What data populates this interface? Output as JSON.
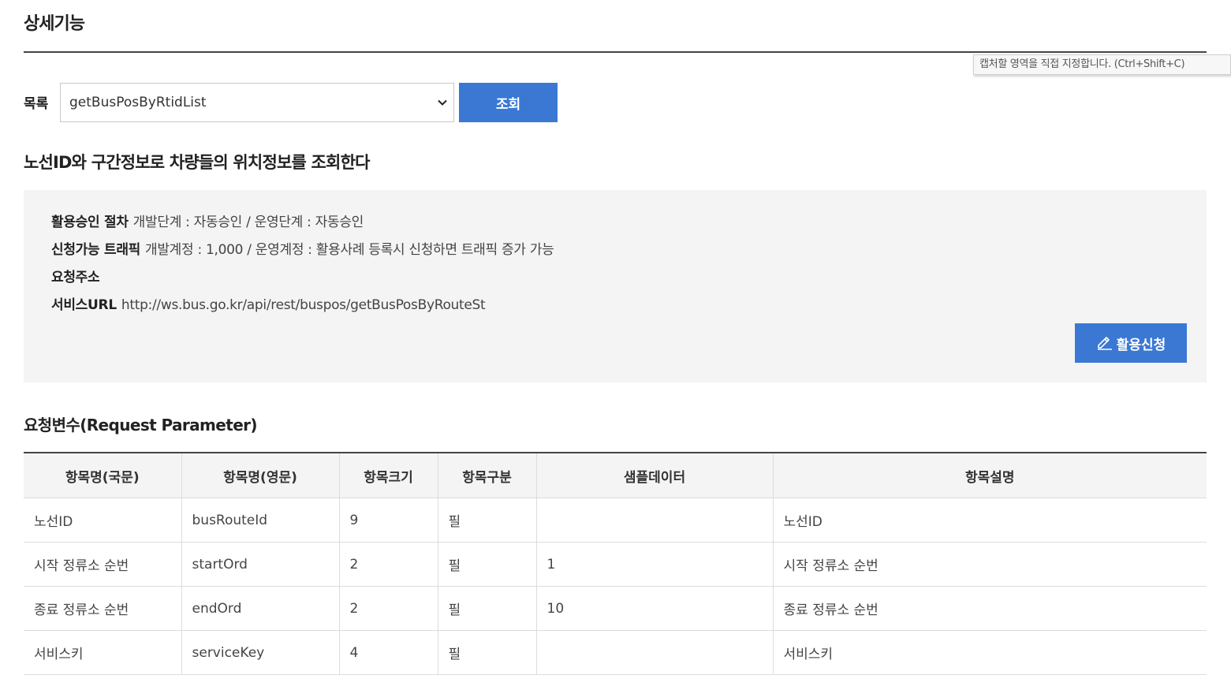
{
  "page_title": "상세기능",
  "tooltip": "캡처할 영역을 직접 지정합니다. (Ctrl+Shift+C)",
  "list": {
    "label": "목록",
    "selected": "getBusPosByRtidList",
    "query_button": "조회"
  },
  "section_heading": "노선ID와 구간정보로 차량들의 위치정보를 조회한다",
  "info": {
    "approval_label": "활용승인 절차",
    "approval_value": "개발단계 : 자동승인 / 운영단계 : 자동승인",
    "traffic_label": "신청가능 트래픽",
    "traffic_value": "개발계정 : 1,000 / 운영계정 : 활용사례 등록시 신청하면 트래픽 증가 가능",
    "request_address_label": "요청주소",
    "service_url_label": "서비스URL",
    "service_url_value": "http://ws.bus.go.kr/api/rest/buspos/getBusPosByRouteSt",
    "apply_button": "활용신청"
  },
  "param_heading": "요청변수(Request Parameter)",
  "table": {
    "headers": [
      "항목명(국문)",
      "항목명(영문)",
      "항목크기",
      "항목구분",
      "샘플데이터",
      "항목설명"
    ],
    "rows": [
      [
        "노선ID",
        "busRouteId",
        "9",
        "필",
        "",
        "노선ID"
      ],
      [
        "시작 정류소 순번",
        "startOrd",
        "2",
        "필",
        "1",
        "시작 정류소 순번"
      ],
      [
        "종료 정류소 순번",
        "endOrd",
        "2",
        "필",
        "10",
        "종료 정류소 순번"
      ],
      [
        "서비스키",
        "serviceKey",
        "4",
        "필",
        "",
        "서비스키"
      ]
    ]
  },
  "colors": {
    "primary_button": "#3a78d4",
    "info_background": "#f4f4f4",
    "rule": "#444444"
  },
  "icons": {
    "select_arrow": "chevron-down-icon",
    "apply": "pencil-icon"
  }
}
